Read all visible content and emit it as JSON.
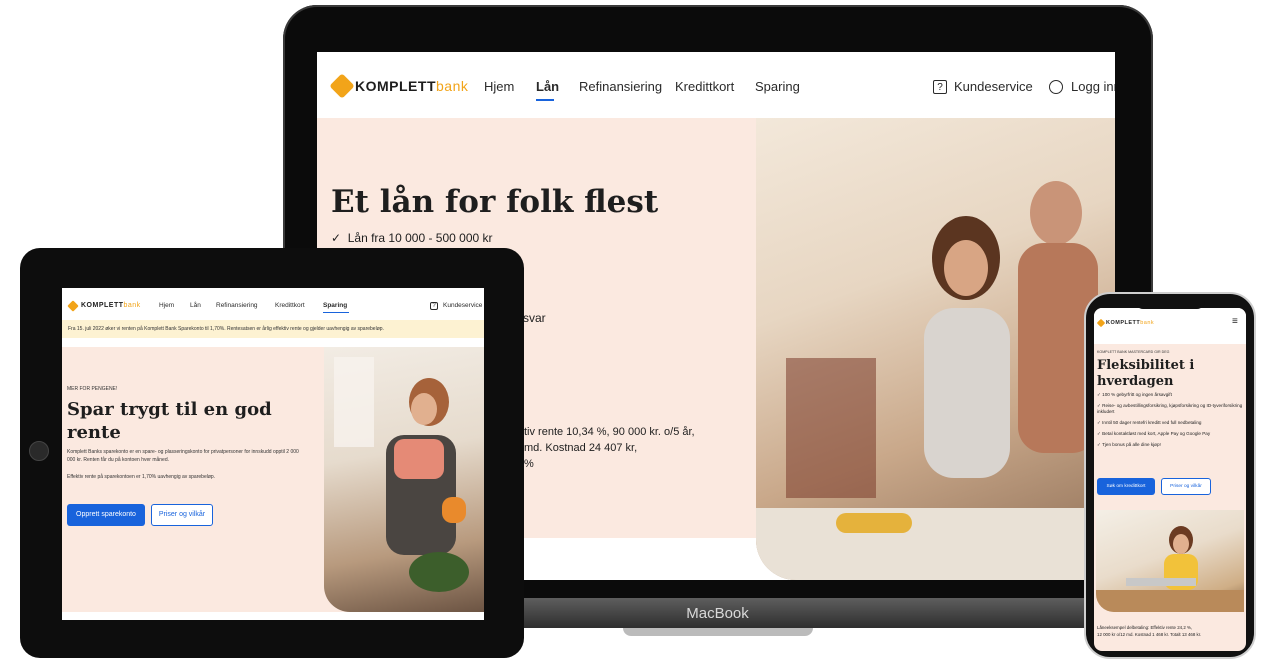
{
  "colors": {
    "accent": "#1863dc",
    "brand_orange": "#f2a419",
    "hero_bg": "#fbe9e0",
    "banner_bg": "#fdf2d2"
  },
  "laptop": {
    "device_label": "MacBook",
    "logo": {
      "text": "KOMPLETT",
      "suffix": "bank"
    },
    "nav": [
      "Hjem",
      "Lån",
      "Refinansiering",
      "Kredittkort",
      "Sparing"
    ],
    "nav_active": "Lån",
    "kundeservice": "Kundeservice",
    "login": "Logg inn",
    "hero": {
      "title": "Et lån for folk flest",
      "check": "Lån fra 10 000 - 500 000 kr",
      "partial_1": "svar",
      "example_1": "tiv rente 10,34 %, 90 000 kr. o/5 år,",
      "example_2": "md. Kostnad 24 407 kr,",
      "example_3": "%"
    }
  },
  "tablet": {
    "logo": {
      "text": "KOMPLETT",
      "suffix": "bank"
    },
    "nav": [
      "Hjem",
      "Lån",
      "Refinansiering",
      "Kredittkort",
      "Sparing"
    ],
    "nav_active": "Sparing",
    "kundeservice": "Kundeservice",
    "banner": "Fra 15. juli 2022 øker vi renten på Komplett Bank Sparekonto til 1,70%. Rentesatsen er årlig effektiv rente og gjelder uavhengig av sparebeløp.",
    "eyebrow": "MER FOR PENGENE!",
    "title": "Spar trygt til en god rente",
    "desc": "Komplett Banks sparekonto er en spare- og plasseringskonto for privatpersoner for innskudd opptil 2 000 000 kr. Renten får du på kontoen hver måned.",
    "rate": "Effektiv rente på sparekontoen er 1,70% uavhengig av sparebeløp.",
    "btn_primary": "Opprett sparekonto",
    "btn_secondary": "Priser og vilkår"
  },
  "phone": {
    "logo": {
      "text": "KOMPLETT",
      "suffix": "bank"
    },
    "menu_icon": "hamburger-icon",
    "eyebrow": "KOMPLETT BANK MASTERCARD GIR DEG",
    "title": "Fleksibilitet i hverdagen",
    "items": [
      "100 % gebyrfritt og ingen årsavgift",
      "Reise- og avbestillingsforsikring, kjøpsforsikring og ID-tyveriforsikring inkludert",
      "Inntil 50 dager rentefri kreditt ved full nedbetaling",
      "Betal kontaktløst med kort, Apple Pay og Google Pay",
      "Tjen bonus på alle dine kjøp!"
    ],
    "btn_primary": "Søk om kredittkort",
    "btn_secondary": "Priser og vilkår",
    "footer_1": "Låneeksempel delbetaling: Effektiv rente 24,2 %,",
    "footer_2": "12 000 kr o/12 md. Kostnad 1 468 kr. Totalt 13 468 kr."
  }
}
